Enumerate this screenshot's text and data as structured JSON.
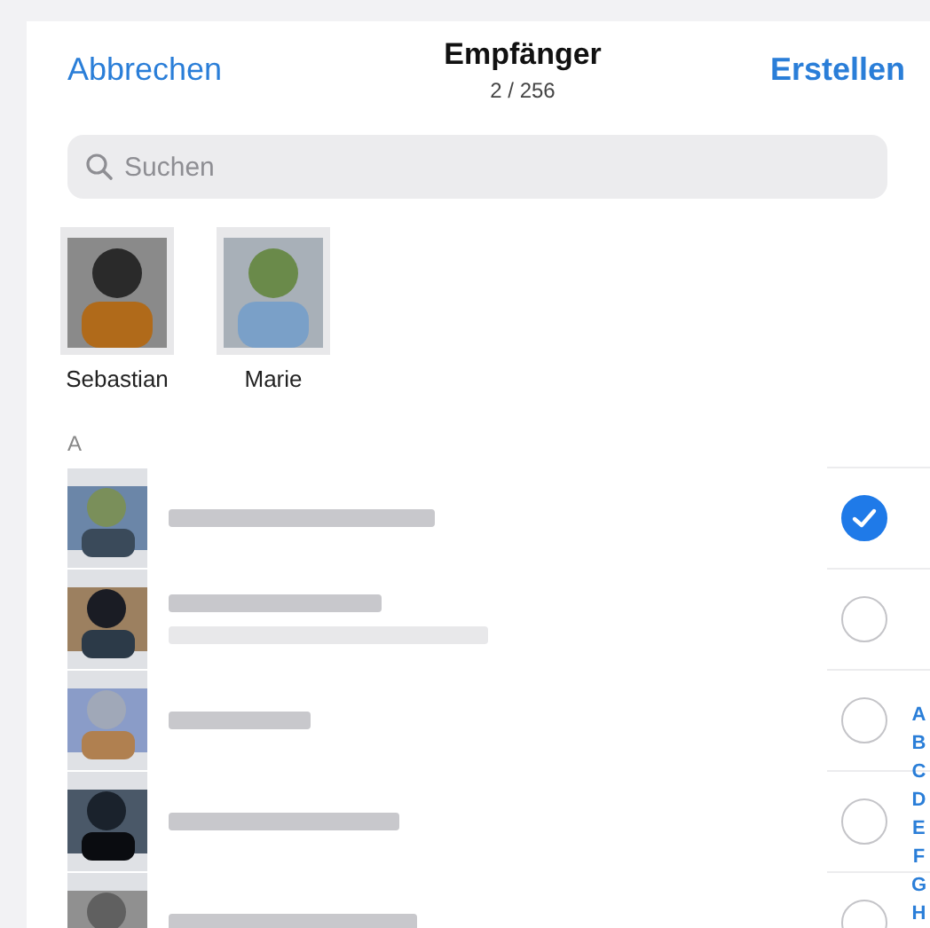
{
  "header": {
    "cancel": "Abbrechen",
    "title": "Empfänger",
    "subtitle": "2 / 256",
    "create": "Erstellen"
  },
  "search": {
    "placeholder": "Suchen"
  },
  "selected_recipients": [
    {
      "name": "Sebastian"
    },
    {
      "name": "Marie"
    }
  ],
  "section": "A",
  "contacts": [
    {
      "selected": true
    },
    {
      "selected": false
    },
    {
      "selected": false
    },
    {
      "selected": false
    },
    {
      "selected": false
    }
  ],
  "index": [
    "A",
    "B",
    "C",
    "D",
    "E",
    "F",
    "G",
    "H"
  ]
}
